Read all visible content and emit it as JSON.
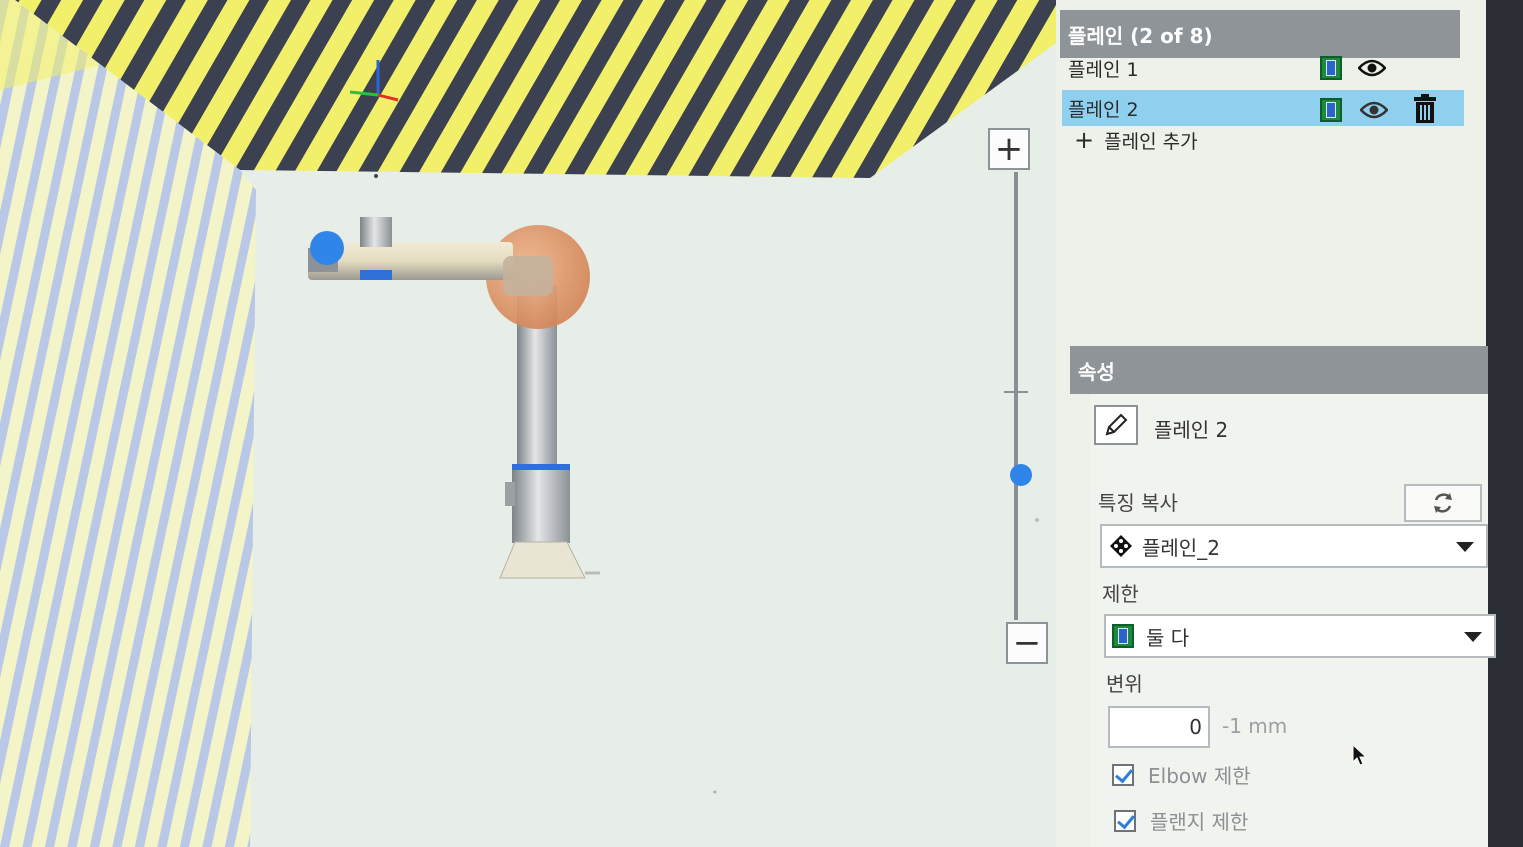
{
  "planes_panel": {
    "header": "플레인 (2 of 8)",
    "items": [
      {
        "label": "플레인 1",
        "selected": false
      },
      {
        "label": "플레인 2",
        "selected": true
      }
    ],
    "add_label": "플레인 추가",
    "selected_row_color": "#8fd0ee"
  },
  "properties": {
    "header": "속성",
    "plane_name": "플레인 2",
    "copy_feature_label": "특징 복사",
    "copy_feature_value": "플레인_2",
    "limit_label": "제한",
    "limit_value": "둘 다",
    "offset_label": "변위",
    "offset_value": "0",
    "offset_unit": "-1 mm",
    "elbow_limit_label": "Elbow 제한",
    "elbow_limit_checked": true,
    "flange_limit_label": "플랜지 제한",
    "flange_limit_checked": true
  },
  "viewport": {
    "zoom_in_label": "+",
    "zoom_out_label": "−",
    "zoom_level": 0.65,
    "stripe_yellow": "#f2f06a",
    "stripe_dark": "#3b4150",
    "stripe_blue": "#b9c8e6",
    "robot_joint_color": "#e39a68",
    "accent_blue": "#2f86e8"
  },
  "icons": [
    "limit-both-icon",
    "eye-icon",
    "trash-icon",
    "plus-icon",
    "pencil-icon",
    "refresh-icon",
    "feature-icon",
    "chevron-down-icon",
    "checkbox-checked-icon",
    "mouse-cursor-icon"
  ]
}
